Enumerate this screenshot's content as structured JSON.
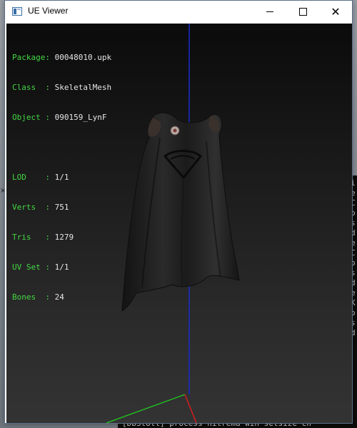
{
  "window": {
    "title": "UE Viewer"
  },
  "info": {
    "package_key": "Package: ",
    "package_val": "00048010.upk",
    "class_key": "Class  : ",
    "class_val": "SkeletalMesh",
    "object_key": "Object : ",
    "object_val": "090159_LynF",
    "lod_key": "LOD    : ",
    "lod_val": "1/1",
    "verts_key": "Verts  : ",
    "verts_val": "751",
    "tris_key": "Tris   : ",
    "tris_val": "1279",
    "uvset_key": "UV Set : ",
    "uvset_val": "1/1",
    "bones_key": "Bones  : ",
    "bones_val": "24"
  },
  "console": {
    "lines": [
      "i",
      "e",
      "C",
      "o",
      "s",
      "d",
      "e",
      "C",
      "o",
      "s",
      "d",
      "e",
      "K",
      "o",
      "s",
      "d"
    ],
    "bottom_text": "[DbStoll] process  hitrema win setsize  ch"
  },
  "colors": {
    "label_green": "#42d742",
    "value_white": "#e6e6e6",
    "axis_blue": "#1a2cc8",
    "axis_green": "#1fd41f",
    "axis_red": "#d41f1f"
  }
}
